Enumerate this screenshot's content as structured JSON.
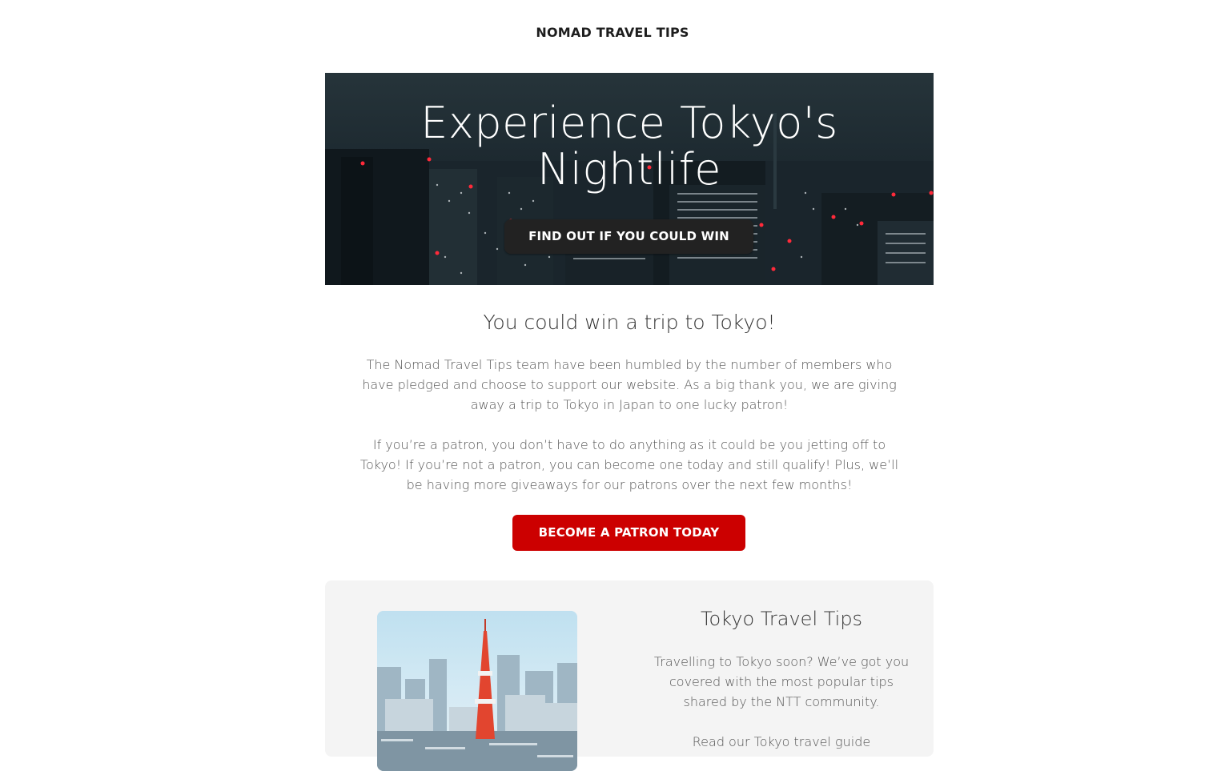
{
  "header": {
    "brand": "NOMAD TRAVEL TIPS"
  },
  "hero": {
    "title_line1": "Experience Tokyo's",
    "title_line2": "Nightlife",
    "button_label": "FIND OUT IF YOU COULD WIN",
    "image": "tokyo-night-skyline"
  },
  "main": {
    "heading": "You could win a trip to Tokyo!",
    "paragraph1": "The Nomad Travel Tips team have been humbled by the number of members who have pledged and choose to support our website. As a big thank you, we are giving away a trip to Tokyo in Japan to one lucky patron!",
    "paragraph2": "If you’re a patron, you don’t have to do anything as it could be you jetting off to Tokyo! If you’re not a patron, you can become one today and still qualify! Plus, we’ll be having more giveaways for our patrons over the next few months!",
    "cta_label": "BECOME A PATRON TODAY"
  },
  "card": {
    "image": "tokyo-tower-daytime",
    "title": "Tokyo Travel Tips",
    "text": "Travelling to Tokyo soon? We’ve got you covered with the most popular tips shared by the NTT community.",
    "text2": "Read our Tokyo travel guide"
  },
  "colors": {
    "accent_red": "#cc0000",
    "dark_button": "#222222",
    "card_bg": "#f4f4f4"
  }
}
